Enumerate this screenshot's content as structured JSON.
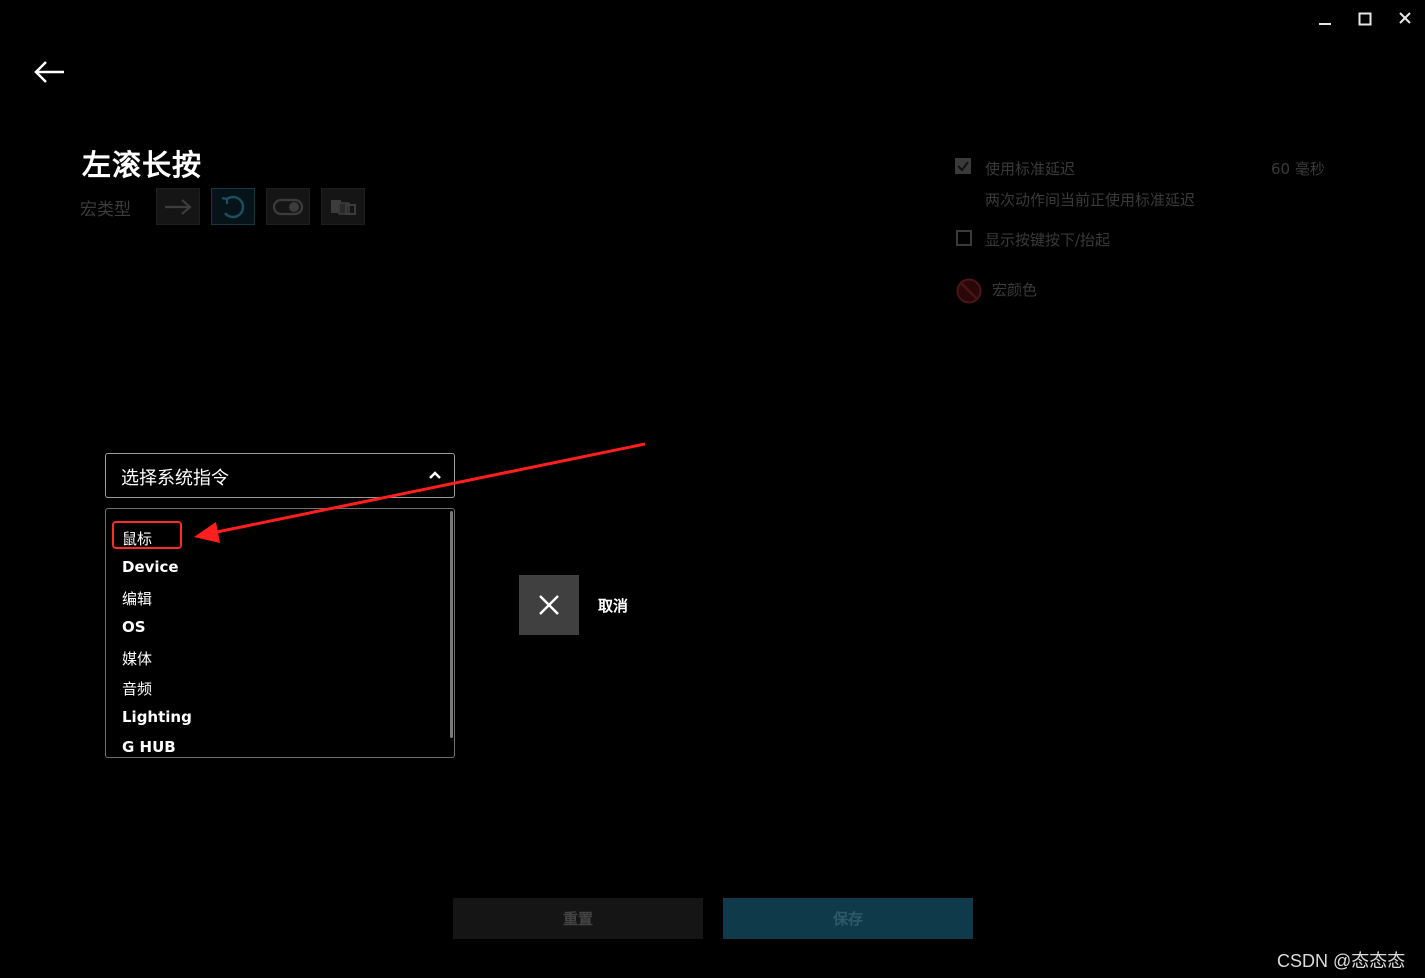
{
  "window_controls": {
    "minimize": "—",
    "maximize": "☐",
    "close": "✕"
  },
  "header": {
    "title": "左滚长按"
  },
  "macro_type": {
    "label": "宏类型",
    "options": [
      {
        "icon": "arrow-right-icon",
        "active": false
      },
      {
        "icon": "repeat-icon",
        "active": true
      },
      {
        "icon": "toggle-icon",
        "active": false
      },
      {
        "icon": "sequence-icon",
        "active": false
      }
    ]
  },
  "options": {
    "standard_delay": {
      "label": "使用标准延迟",
      "checked": true,
      "value": "60 毫秒",
      "description": "两次动作间当前正使用标准延迟"
    },
    "show_keys": {
      "label": "显示按键按下/抬起",
      "checked": false
    },
    "macro_color": {
      "label": "宏颜色",
      "icon": "no-color-icon"
    }
  },
  "dropdown": {
    "selected": "选择系统指令",
    "expanded": true,
    "items": [
      "鼠标",
      "Device",
      "编辑",
      "OS",
      "媒体",
      "音频",
      "Lighting",
      "G HUB"
    ],
    "highlighted_item": "鼠标"
  },
  "cancel": {
    "label": "取消"
  },
  "footer": {
    "reset_label": "重置",
    "save_label": "保存"
  },
  "watermark": "CSDN @态态态",
  "colors": {
    "background": "#000000",
    "annotation": "#ff2a2a",
    "save_bg": "#0f3a4a"
  }
}
